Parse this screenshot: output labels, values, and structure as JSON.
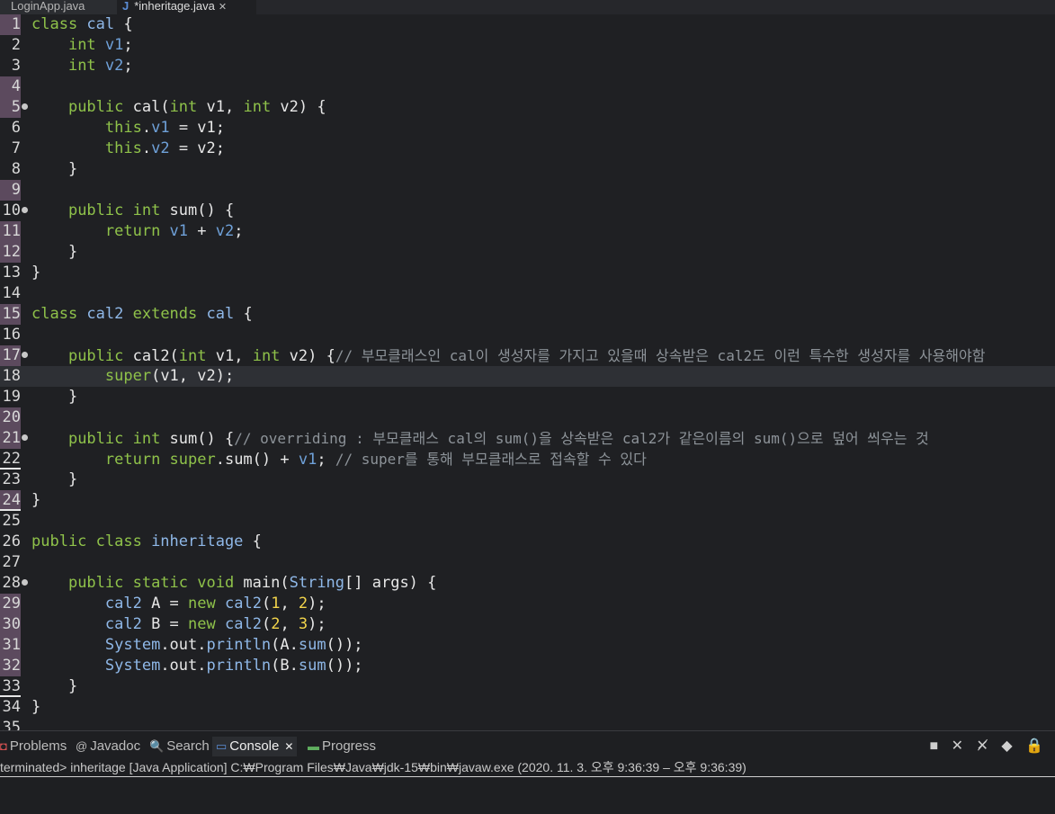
{
  "tabs": [
    {
      "label": "LoginApp.java"
    },
    {
      "icon": "J",
      "label": "*inheritage.java",
      "close": "✕"
    }
  ],
  "colors": {
    "keyword": "#8fc24a",
    "field": "#6fa1d9",
    "class": "#8fb8e8",
    "number": "#f3d54b",
    "comment": "#8d9399",
    "text": "#e7e7e7"
  },
  "code_lines": [
    {
      "n": "1",
      "mark": true,
      "segs": [
        [
          "kw",
          "class "
        ],
        [
          "cls",
          "cal "
        ],
        [
          "p",
          "{"
        ]
      ]
    },
    {
      "n": "2",
      "segs": [
        [
          "p",
          "    "
        ],
        [
          "kw",
          "int "
        ],
        [
          "fld",
          "v1"
        ],
        [
          "p",
          ";"
        ]
      ]
    },
    {
      "n": "3",
      "segs": [
        [
          "p",
          "    "
        ],
        [
          "kw",
          "int "
        ],
        [
          "fld",
          "v2"
        ],
        [
          "p",
          ";"
        ]
      ]
    },
    {
      "n": "4",
      "mark": true,
      "segs": []
    },
    {
      "n": "5",
      "mark": true,
      "fold": true,
      "segs": [
        [
          "p",
          "    "
        ],
        [
          "kw",
          "public "
        ],
        [
          "p",
          "cal("
        ],
        [
          "kw",
          "int "
        ],
        [
          "p",
          "v1, "
        ],
        [
          "kw",
          "int "
        ],
        [
          "p",
          "v2) {"
        ]
      ]
    },
    {
      "n": "6",
      "segs": [
        [
          "p",
          "        "
        ],
        [
          "kw",
          "this"
        ],
        [
          "p",
          "."
        ],
        [
          "fld",
          "v1"
        ],
        [
          "p",
          " = v1;"
        ]
      ]
    },
    {
      "n": "7",
      "segs": [
        [
          "p",
          "        "
        ],
        [
          "kw",
          "this"
        ],
        [
          "p",
          "."
        ],
        [
          "fld",
          "v2"
        ],
        [
          "p",
          " = v2;"
        ]
      ]
    },
    {
      "n": "8",
      "segs": [
        [
          "p",
          "    }"
        ]
      ]
    },
    {
      "n": "9",
      "mark": true,
      "segs": []
    },
    {
      "n": "10",
      "fold": true,
      "segs": [
        [
          "p",
          "    "
        ],
        [
          "kw",
          "public int "
        ],
        [
          "p",
          "sum() {"
        ]
      ]
    },
    {
      "n": "11",
      "mark": true,
      "segs": [
        [
          "p",
          "        "
        ],
        [
          "kw",
          "return "
        ],
        [
          "fld",
          "v1"
        ],
        [
          "p",
          " + "
        ],
        [
          "fld",
          "v2"
        ],
        [
          "p",
          ";"
        ]
      ]
    },
    {
      "n": "12",
      "mark": true,
      "segs": [
        [
          "p",
          "    }"
        ]
      ]
    },
    {
      "n": "13",
      "segs": [
        [
          "p",
          "}"
        ]
      ]
    },
    {
      "n": "14",
      "segs": []
    },
    {
      "n": "15",
      "mark": true,
      "segs": [
        [
          "kw",
          "class "
        ],
        [
          "cls",
          "cal2 "
        ],
        [
          "kw",
          "extends "
        ],
        [
          "cls",
          "cal "
        ],
        [
          "p",
          "{"
        ]
      ]
    },
    {
      "n": "16",
      "segs": []
    },
    {
      "n": "17",
      "mark": true,
      "fold": true,
      "segs": [
        [
          "p",
          "    "
        ],
        [
          "kw",
          "public "
        ],
        [
          "p",
          "cal2("
        ],
        [
          "kw",
          "int "
        ],
        [
          "p",
          "v1, "
        ],
        [
          "kw",
          "int "
        ],
        [
          "p",
          "v2) {"
        ],
        [
          "cmt",
          "// 부모클래스인 cal이 생성자를 가지고 있을때 상속받은 cal2도 이런 특수한 생성자를 사용해야함"
        ]
      ]
    },
    {
      "n": "18",
      "current": true,
      "segs": [
        [
          "p",
          "        "
        ],
        [
          "kw",
          "super"
        ],
        [
          "p",
          "(v1, v2);"
        ]
      ]
    },
    {
      "n": "19",
      "segs": [
        [
          "p",
          "    }"
        ]
      ]
    },
    {
      "n": "20",
      "mark": true,
      "segs": []
    },
    {
      "n": "21",
      "mark": true,
      "fold": true,
      "segs": [
        [
          "p",
          "    "
        ],
        [
          "kw",
          "public int "
        ],
        [
          "p",
          "sum() {"
        ],
        [
          "cmt",
          "// overriding : 부모클래스 cal의 sum()을 상속받은 cal2가 같은이름의 sum()으로 덮어 씌우는 것"
        ]
      ]
    },
    {
      "n": "22",
      "under": true,
      "segs": [
        [
          "p",
          "        "
        ],
        [
          "kw",
          "return super"
        ],
        [
          "p",
          ".sum() + "
        ],
        [
          "fld",
          "v1"
        ],
        [
          "p",
          "; "
        ],
        [
          "cmt",
          "// super를 통해 부모클래스로 접속할 수 있다"
        ]
      ]
    },
    {
      "n": "23",
      "segs": [
        [
          "p",
          "    }"
        ]
      ]
    },
    {
      "n": "24",
      "mark": true,
      "under": true,
      "segs": [
        [
          "p",
          "}"
        ]
      ]
    },
    {
      "n": "25",
      "segs": []
    },
    {
      "n": "26",
      "segs": [
        [
          "kw",
          "public class "
        ],
        [
          "cls",
          "inheritage "
        ],
        [
          "p",
          "{"
        ]
      ]
    },
    {
      "n": "27",
      "segs": []
    },
    {
      "n": "28",
      "fold": true,
      "segs": [
        [
          "p",
          "    "
        ],
        [
          "kw",
          "public static void "
        ],
        [
          "p",
          "main("
        ],
        [
          "cls",
          "String"
        ],
        [
          "p",
          "[] args) {"
        ]
      ]
    },
    {
      "n": "29",
      "mark": true,
      "segs": [
        [
          "p",
          "        "
        ],
        [
          "cls",
          "cal2 "
        ],
        [
          "p",
          "A = "
        ],
        [
          "kw",
          "new "
        ],
        [
          "cls",
          "cal2"
        ],
        [
          "p",
          "("
        ],
        [
          "num",
          "1"
        ],
        [
          "p",
          ", "
        ],
        [
          "num",
          "2"
        ],
        [
          "p",
          ");"
        ]
      ]
    },
    {
      "n": "30",
      "mark": true,
      "segs": [
        [
          "p",
          "        "
        ],
        [
          "cls",
          "cal2 "
        ],
        [
          "p",
          "B = "
        ],
        [
          "kw",
          "new "
        ],
        [
          "cls",
          "cal2"
        ],
        [
          "p",
          "("
        ],
        [
          "num",
          "2"
        ],
        [
          "p",
          ", "
        ],
        [
          "num",
          "3"
        ],
        [
          "p",
          ");"
        ]
      ]
    },
    {
      "n": "31",
      "mark": true,
      "segs": [
        [
          "p",
          "        "
        ],
        [
          "cls",
          "System"
        ],
        [
          "p",
          ".out."
        ],
        [
          "cls",
          "println"
        ],
        [
          "p",
          "(A."
        ],
        [
          "cls",
          "sum"
        ],
        [
          "p",
          "());"
        ]
      ]
    },
    {
      "n": "32",
      "mark": true,
      "segs": [
        [
          "p",
          "        "
        ],
        [
          "cls",
          "System"
        ],
        [
          "p",
          ".out."
        ],
        [
          "cls",
          "println"
        ],
        [
          "p",
          "(B."
        ],
        [
          "cls",
          "sum"
        ],
        [
          "p",
          "());"
        ]
      ]
    },
    {
      "n": "33",
      "under": true,
      "segs": [
        [
          "p",
          "    }"
        ]
      ]
    },
    {
      "n": "34",
      "segs": [
        [
          "p",
          "}"
        ]
      ]
    },
    {
      "n": "35",
      "segs": []
    }
  ],
  "panel": {
    "tabs": [
      {
        "icon": "◘",
        "label": "Problems"
      },
      {
        "icon": "@",
        "label": "Javadoc"
      },
      {
        "icon": "🔍",
        "label": "Search"
      },
      {
        "icon": "▭",
        "label": "Console",
        "close": "✕"
      },
      {
        "icon": "▬",
        "label": "Progress"
      }
    ],
    "tool_icons": "■ ✕ ✕̸ ◆ 🔒",
    "status": "terminated> inheritage [Java Application] C:₩Program Files₩Java₩jdk-15₩bin₩javaw.exe  (2020. 11. 3. 오후 9:36:39 – 오후 9:36:39)"
  }
}
